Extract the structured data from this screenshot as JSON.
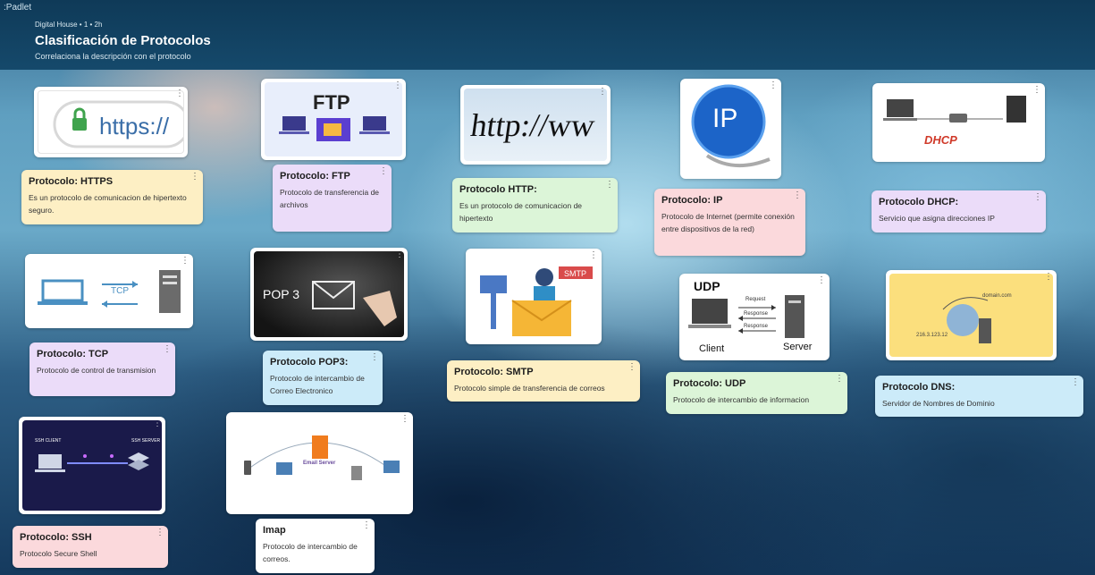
{
  "app": {
    "logo": ":Padlet"
  },
  "header": {
    "meta": "Digital House • 1 • 2h",
    "title": "Clasificación de Protocolos",
    "subtitle": "Correlaciona la descripción con el protocolo"
  },
  "images": {
    "https": "https://",
    "ftp": "FTP",
    "http": "http://ww",
    "ip": "IP",
    "dhcp": "DHCP",
    "pop3": "POP 3",
    "smtp": "SMTP",
    "udp": "UDP",
    "udp_client": "Client",
    "udp_server": "Server",
    "udp_request": "Request",
    "udp_response": "Response",
    "tcp": "TCP",
    "ssh_client": "SSH CLIENT",
    "ssh_server": "SSH SERVER",
    "imap_server": "Email Server",
    "dns_domain": "domain.com",
    "dns_ip": "216.3.123.12"
  },
  "posts": [
    {
      "title": "Protocolo: HTTPS",
      "body": "Es un protocolo de comunicacion de hipertexto seguro."
    },
    {
      "title": "Protocolo: FTP",
      "body": "Protocolo de transferencia de archivos"
    },
    {
      "title": "Protocolo HTTP:",
      "body": "Es un protocolo de comunicacion de hipertexto"
    },
    {
      "title": "Protocolo: IP",
      "body": "Protocolo de Internet (permite conexión entre dispositivos de la red)"
    },
    {
      "title": "Protocolo DHCP:",
      "body": "Servicio que asigna direcciones IP"
    },
    {
      "title": "Protocolo: TCP",
      "body": "Protocolo de control de transmision"
    },
    {
      "title": "Protocolo POP3:",
      "body": "Protocolo de intercambio de Correo Electronico"
    },
    {
      "title": "Protocolo: SMTP",
      "body": "Protocolo simple de transferencia de correos"
    },
    {
      "title": "Protocolo: UDP",
      "body": "Protocolo de intercambio de informacion"
    },
    {
      "title": "Protocolo DNS:",
      "body": "Servidor de Nombres de Dominio"
    },
    {
      "title": "Protocolo: SSH",
      "body": "Protocolo Secure Shell"
    },
    {
      "title": "Imap",
      "body": "Protocolo de intercambio de correos."
    }
  ],
  "menu_icon": "⋮",
  "colors": {
    "yellow": "#fdefc4",
    "purple": "#ebdcf9",
    "green": "#dcf5d8",
    "pink": "#fbd9dc",
    "blue": "#ccebf9"
  }
}
